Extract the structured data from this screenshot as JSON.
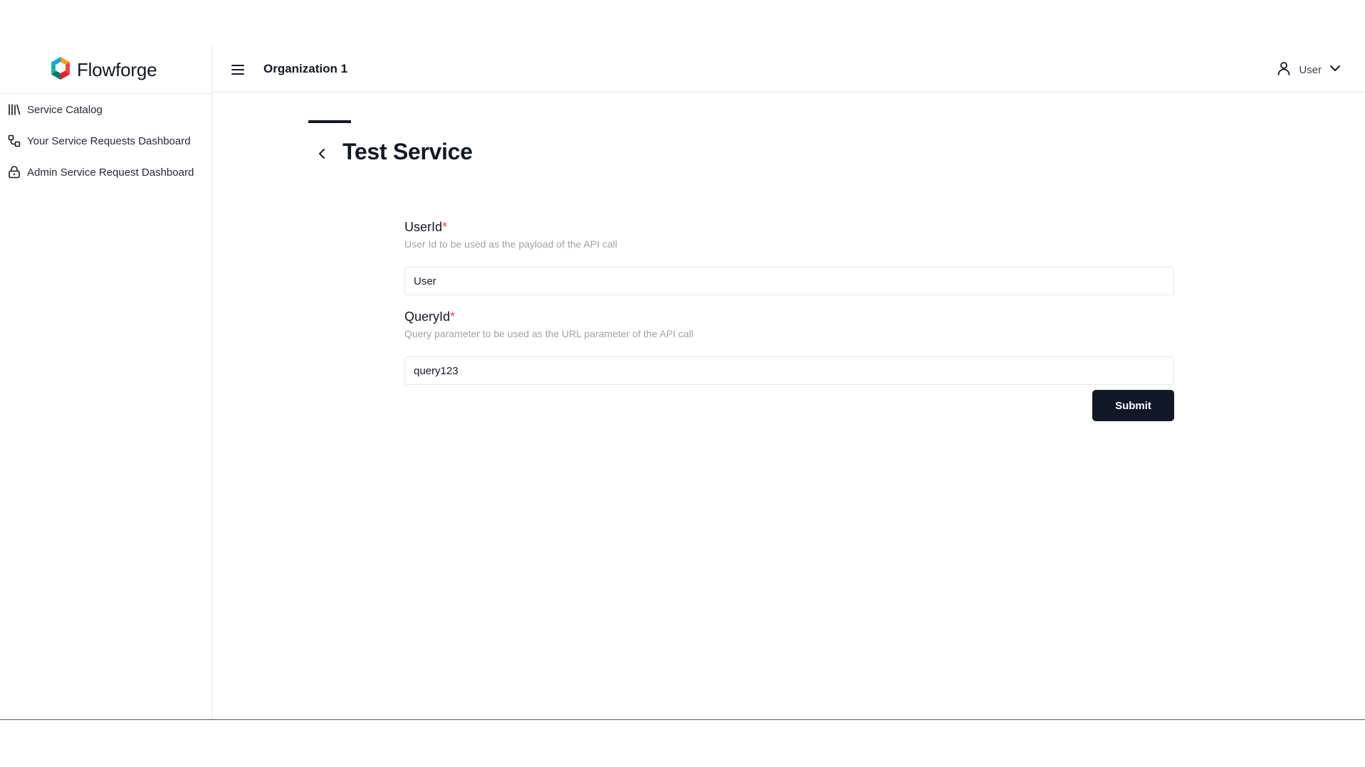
{
  "app": {
    "name": "Flowforge"
  },
  "header": {
    "organization": "Organization 1",
    "user_label": "User"
  },
  "sidebar": {
    "items": [
      {
        "label": "Service Catalog",
        "icon": "library-icon"
      },
      {
        "label": "Your Service Requests Dashboard",
        "icon": "workflow-icon"
      },
      {
        "label": "Admin Service Request Dashboard",
        "icon": "lock-icon"
      }
    ]
  },
  "page": {
    "title": "Test Service"
  },
  "form": {
    "fields": [
      {
        "label": "UserId",
        "required_mark": "*",
        "help": "User Id to be used as the payload of the API call",
        "value": "User"
      },
      {
        "label": "QueryId",
        "required_mark": "*",
        "help": "Query parameter to be used as the URL parameter of the API call",
        "value": "query123"
      }
    ],
    "submit_label": "Submit"
  },
  "colors": {
    "primary": "#111827",
    "required": "#ef4444",
    "help_text": "#9ca3af",
    "border": "#e5e7eb"
  }
}
